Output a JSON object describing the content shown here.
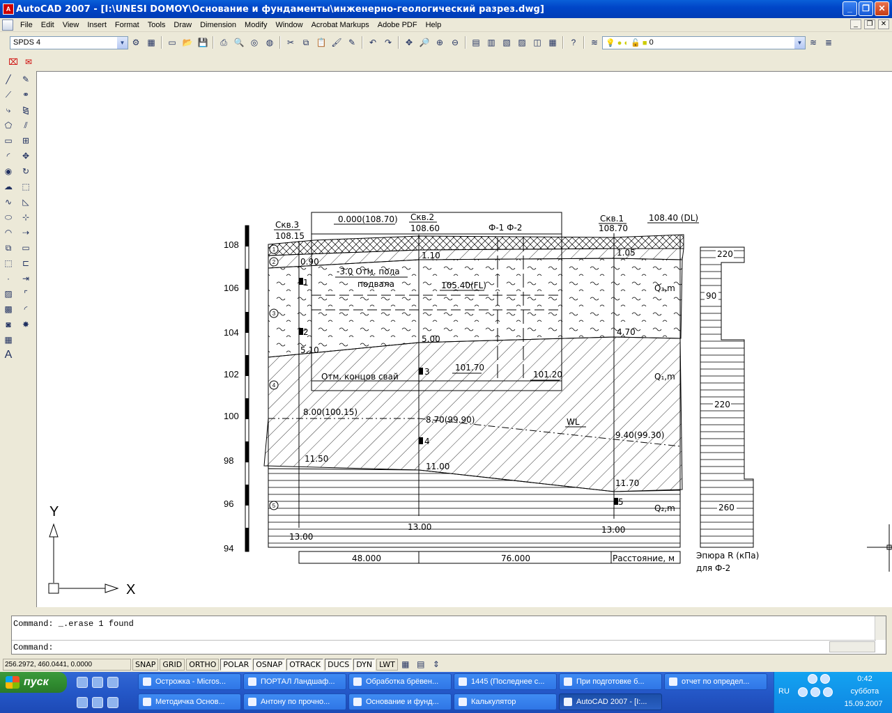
{
  "window": {
    "title": "AutoCAD 2007 - [I:\\UNESI DOMOY\\Основание и фундаменты\\инженерно-геологический разрез.dwg]"
  },
  "menu": [
    "File",
    "Edit",
    "View",
    "Insert",
    "Format",
    "Tools",
    "Draw",
    "Dimension",
    "Modify",
    "Window",
    "Acrobat Markups",
    "Adobe PDF",
    "Help"
  ],
  "toolbar": {
    "style_combo": "SPDS 4",
    "layer_combo": "0"
  },
  "drawing": {
    "elev_labels": [
      "108",
      "106",
      "104",
      "102",
      "100",
      "98",
      "96",
      "94"
    ],
    "wells": [
      {
        "name": "Скв.3",
        "elev": "108.15"
      },
      {
        "name": "Скв.2",
        "elev": "108.60"
      },
      {
        "name": "Скв.1",
        "elev": "108.70"
      }
    ],
    "top_label": "0.000(108.70)",
    "dl_label": "108.40 (DL)",
    "foundations": "Ф-1  Ф-2",
    "layer_nums": [
      "1",
      "2",
      "3",
      "4",
      "5"
    ],
    "depths": {
      "d090": "0.90",
      "d110": "1.10",
      "d105": "1.05",
      "d510": "5.10",
      "d500": "5.00",
      "d470": "4.70",
      "d800": "8.00(100.15)",
      "d870": "8.70(99.90)",
      "d940": "9.40(99.30)",
      "d1150": "11.50",
      "d1100": "11.00",
      "d1170": "11.70",
      "d1300a": "13.00",
      "d1300b": "13.00",
      "d1300c": "13.00"
    },
    "basement_1": "-3.0 Отм. пола",
    "basement_2": "подвала",
    "fl_label": "105.40(FL)",
    "pile_ends": "Отм. концов свай",
    "pile_e1": "101.70",
    "pile_e2": "101.20",
    "wl": "WL",
    "sample_nums": [
      "1",
      "2",
      "3",
      "4",
      "5"
    ],
    "strat": {
      "q3": "Q₃,m",
      "q1": "Q₁,m",
      "q2": "Q₂,m"
    },
    "distances": {
      "d1": "48.000",
      "d2": "76.000",
      "label": "Расстояние, м"
    },
    "epure": {
      "v220a": "220",
      "v90": "90",
      "v220b": "220",
      "v260": "260",
      "title": "Эпюра R (кПа)",
      "subtitle": "для Ф-2"
    },
    "ucs": {
      "x": "X",
      "y": "Y"
    }
  },
  "command": {
    "line1": "Command:  _.erase 1 found",
    "line2": "Command:"
  },
  "status": {
    "coords": "256.2972, 460.0441, 0.0000",
    "buttons": [
      "SNAP",
      "GRID",
      "ORTHO",
      "POLAR",
      "OSNAP",
      "OTRACK",
      "DUCS",
      "DYN",
      "LWT"
    ],
    "active": [
      "POLAR",
      "OSNAP",
      "OTRACK",
      "DUCS",
      "DYN"
    ]
  },
  "taskbar": {
    "start": "пуск",
    "row1": [
      "Острожка - Micros...",
      "ПОРТАЛ Ландшаф...",
      "Обработка брёвен...",
      "1445 (Последнее с...",
      "При подготовке б...",
      "отчет по определ..."
    ],
    "row2": [
      "Методичка Основ...",
      "Антону по прочно...",
      "Основание и фунд...",
      "Калькулятор",
      "AutoCAD 2007 - [I:..."
    ],
    "lang": "RU",
    "time": "0:42",
    "day": "суббота",
    "date": "15.09.2007"
  }
}
